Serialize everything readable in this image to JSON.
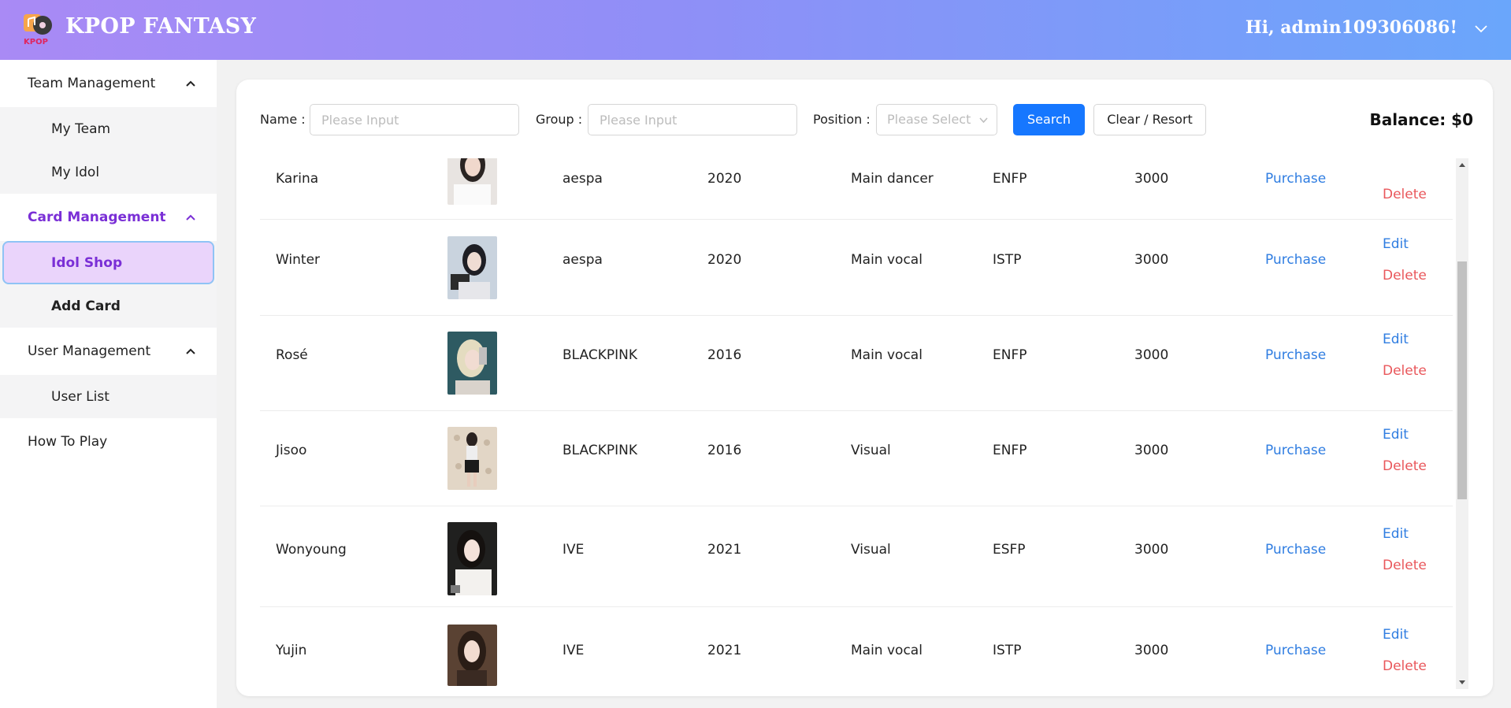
{
  "header": {
    "brand": "KPOP FANTASY",
    "logo_text": "KPOP",
    "greeting": "Hi, admin109306086!"
  },
  "sidebar": {
    "groups": [
      {
        "title": "Team Management",
        "items": [
          "My Team",
          "My Idol"
        ]
      },
      {
        "title": "Card Management",
        "items": [
          "Idol Shop",
          "Add Card"
        ]
      },
      {
        "title": "User Management",
        "items": [
          "User List"
        ]
      }
    ],
    "footer_item": "How To Play"
  },
  "filters": {
    "name_label": "Name",
    "name_placeholder": "Please Input",
    "group_label": "Group",
    "group_placeholder": "Please Input",
    "position_label": "Position",
    "position_placeholder": "Please Select",
    "search_label": "Search",
    "clear_label": "Clear / Resort",
    "balance": "Balance: $0"
  },
  "actions": {
    "purchase": "Purchase",
    "edit": "Edit",
    "delete": "Delete"
  },
  "rows": [
    {
      "name": "Karina",
      "group": "aespa",
      "year": "2020",
      "position": "Main dancer",
      "mbti": "ENFP",
      "price": "3000"
    },
    {
      "name": "Winter",
      "group": "aespa",
      "year": "2020",
      "position": "Main vocal",
      "mbti": "ISTP",
      "price": "3000"
    },
    {
      "name": "Rosé",
      "group": "BLACKPINK",
      "year": "2016",
      "position": "Main vocal",
      "mbti": "ENFP",
      "price": "3000"
    },
    {
      "name": "Jisoo",
      "group": "BLACKPINK",
      "year": "2016",
      "position": "Visual",
      "mbti": "ENFP",
      "price": "3000"
    },
    {
      "name": "Wonyoung",
      "group": "IVE",
      "year": "2021",
      "position": "Visual",
      "mbti": "ESFP",
      "price": "3000"
    },
    {
      "name": "Yujin",
      "group": "IVE",
      "year": "2021",
      "position": "Main vocal",
      "mbti": "ISTP",
      "price": "3000"
    }
  ],
  "colors": {
    "accent": "#7a2fd6",
    "primary": "#1677ff",
    "link": "#2f7de1",
    "danger": "#e9575b"
  }
}
